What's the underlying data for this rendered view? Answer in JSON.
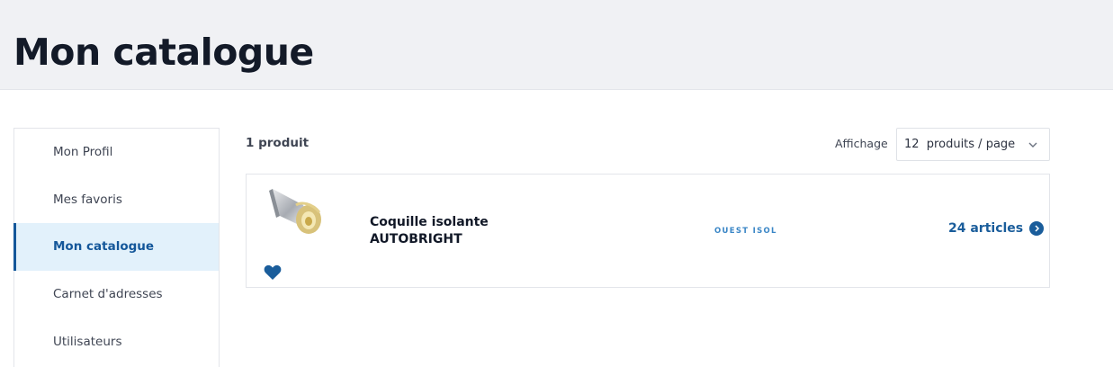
{
  "header": {
    "title": "Mon catalogue"
  },
  "sidebar": {
    "items": [
      {
        "label": "Mon Profil",
        "active": false
      },
      {
        "label": "Mes favoris",
        "active": false
      },
      {
        "label": "Mon catalogue",
        "active": true
      },
      {
        "label": "Carnet d'adresses",
        "active": false
      },
      {
        "label": "Utilisateurs",
        "active": false
      }
    ]
  },
  "results": {
    "count_label": "1 produit",
    "display_label": "Affichage",
    "per_page_selected": "12  produits / page"
  },
  "products": [
    {
      "name_line1": "Coquille isolante",
      "name_line2": "AUTOBRIGHT",
      "brand": "OUEST ISOL",
      "articles_label": "24 articles",
      "favorite": true
    }
  ],
  "colors": {
    "accent": "#1a5d9b",
    "brand_text": "#3a86c6",
    "active_bg": "#e2f1fb",
    "header_bg": "#f0f1f4"
  },
  "icons": [
    "chevron-down-icon",
    "heart-icon",
    "arrow-circle-icon",
    "product-image"
  ]
}
